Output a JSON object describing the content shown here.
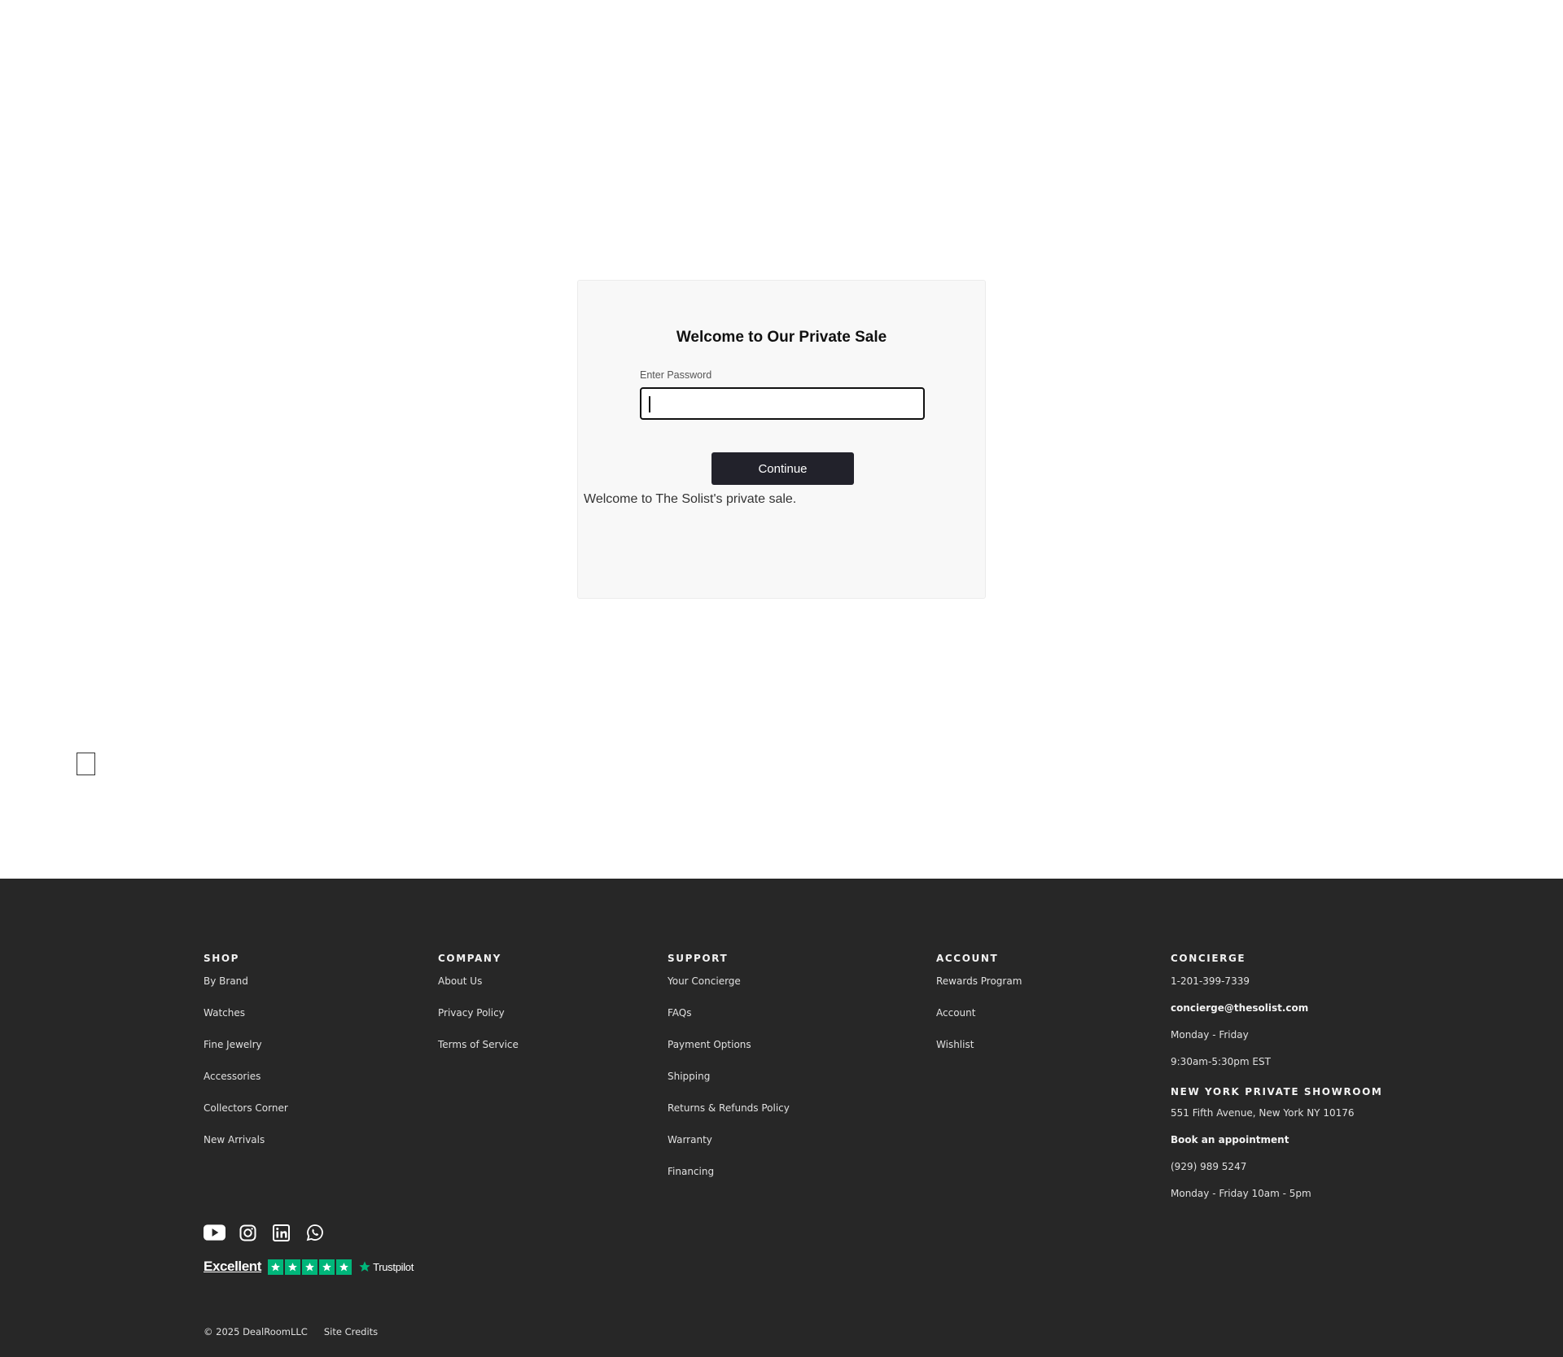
{
  "modal": {
    "title": "Welcome to Our Private Sale",
    "password_label": "Enter Password",
    "password_value": "",
    "continue_label": "Continue",
    "message": "Welcome to The Solist's private sale."
  },
  "footer": {
    "shop": {
      "heading": "SHOP",
      "items": [
        "By Brand",
        "Watches",
        "Fine Jewelry",
        "Accessories",
        "Collectors Corner",
        "New Arrivals"
      ]
    },
    "company": {
      "heading": "COMPANY",
      "items": [
        "About Us",
        "Privacy Policy",
        "Terms of Service"
      ]
    },
    "support": {
      "heading": "SUPPORT",
      "items": [
        "Your Concierge",
        "FAQs",
        "Payment Options",
        "Shipping",
        "Returns & Refunds Policy",
        "Warranty",
        "Financing"
      ]
    },
    "account": {
      "heading": "ACCOUNT",
      "items": [
        "Rewards Program",
        "Account",
        "Wishlist"
      ]
    },
    "concierge": {
      "heading": "CONCIERGE",
      "phone": "1-201-399-7339",
      "email": "concierge@thesolist.com",
      "days": "Monday - Friday",
      "hours": "9:30am-5:30pm EST"
    },
    "showroom": {
      "heading": "NEW YORK PRIVATE SHOWROOM",
      "address": "551 Fifth Avenue, New York NY 10176",
      "appointment": "Book an appointment",
      "phone": "(929) 989 5247",
      "hours": "Monday - Friday 10am - 5pm"
    },
    "social_icons": [
      "youtube-icon",
      "instagram-icon",
      "linkedin-icon",
      "whatsapp-icon"
    ],
    "trustpilot": {
      "rating_word": "Excellent",
      "stars": 5,
      "brand": "Trustpilot",
      "star_color": "#00b67a"
    },
    "copyright": "© 2025 DealRoomLLC",
    "site_credits": "Site Credits"
  },
  "colors": {
    "footer_bg": "#272727",
    "button_bg": "#22222b",
    "card_bg": "#f8f8f8"
  }
}
